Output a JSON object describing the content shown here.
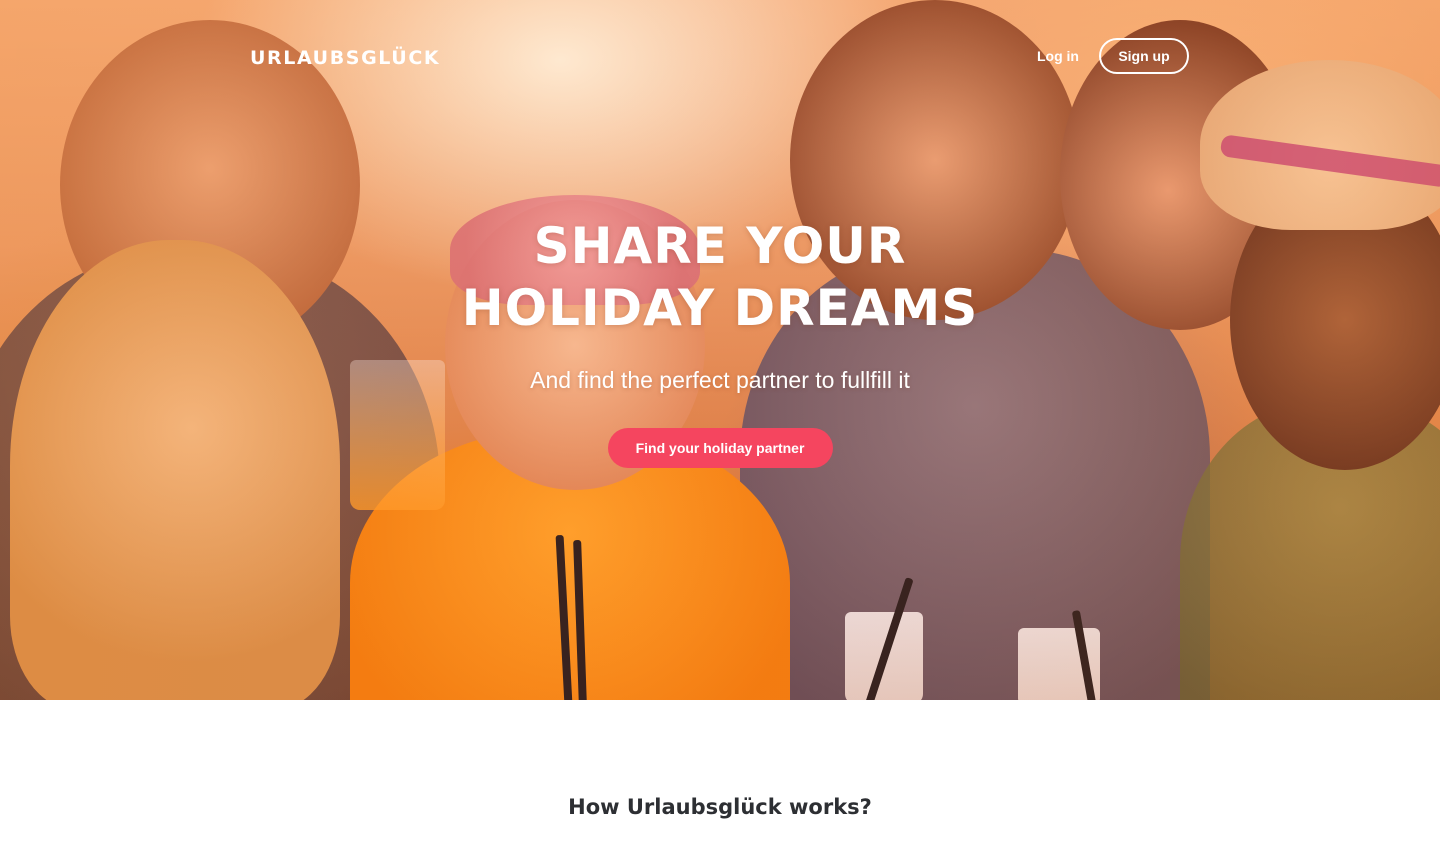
{
  "nav": {
    "brand": "URLAUBSGLÜCK",
    "login_label": "Log in",
    "signup_label": "Sign up"
  },
  "hero": {
    "headline_line1": "SHARE YOUR",
    "headline_line2": "HOLIDAY DREAMS",
    "subtitle": "And find the perfect partner to fullfill it",
    "cta_label": "Find your holiday partner",
    "image": "group-of-friends-laughing-photo"
  },
  "how": {
    "title": "How Urlaubsglück works?"
  },
  "colors": {
    "cta_background": "#f5455f",
    "text_on_hero": "#ffffff",
    "section_title": "#2d2f33",
    "page_background": "#ffffff"
  }
}
